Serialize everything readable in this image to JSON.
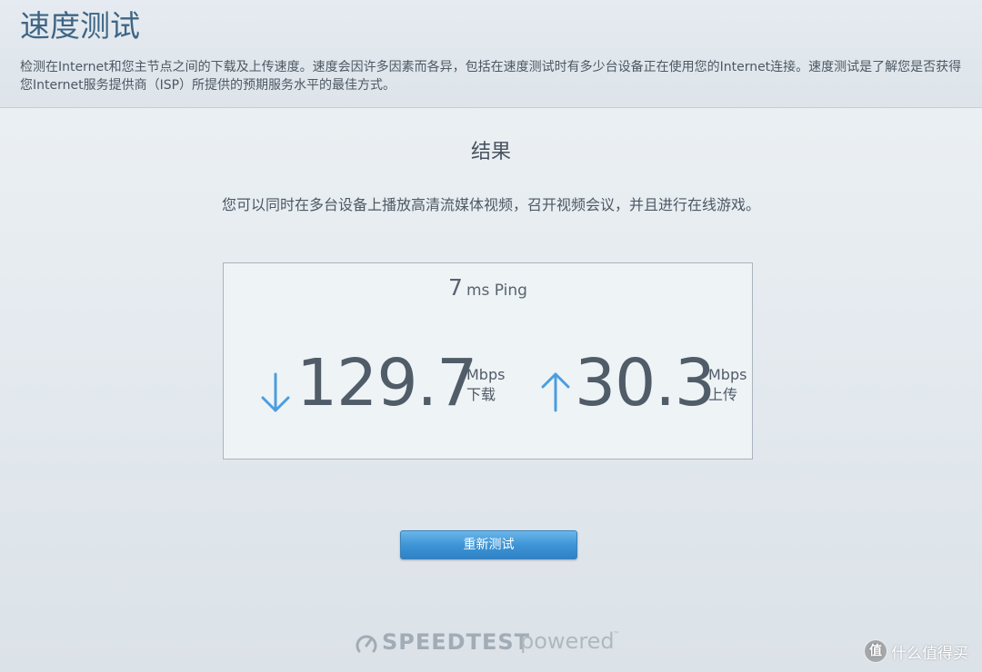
{
  "header": {
    "title": "速度测试",
    "description": "检测在Internet和您主节点之间的下载及上传速度。速度会因许多因素而各异，包括在速度测试时有多少台设备正在使用您的Internet连接。速度测试是了解您是否获得您Internet服务提供商（ISP）所提供的预期服务水平的最佳方式。"
  },
  "result": {
    "heading": "结果",
    "message": "您可以同时在多台设备上播放高清流媒体视频，召开视频会议，并且进行在线游戏。",
    "ping": {
      "value": "7",
      "unit": "ms Ping"
    },
    "download": {
      "value": "129.7",
      "unit": "Mbps",
      "label": "下载",
      "icon": "arrow-down-icon"
    },
    "upload": {
      "value": "30.3",
      "unit": "Mbps",
      "label": "上传",
      "icon": "arrow-up-icon"
    }
  },
  "actions": {
    "retest_label": "重新测试"
  },
  "footer": {
    "brand": "SPEEDTEST",
    "powered": "powered",
    "tm": "™"
  },
  "watermark": {
    "icon_text": "值",
    "text": "什么值得买"
  },
  "colors": {
    "title": "#3e6585",
    "arrow": "#4a9ee0",
    "button": "#3e95d6"
  }
}
